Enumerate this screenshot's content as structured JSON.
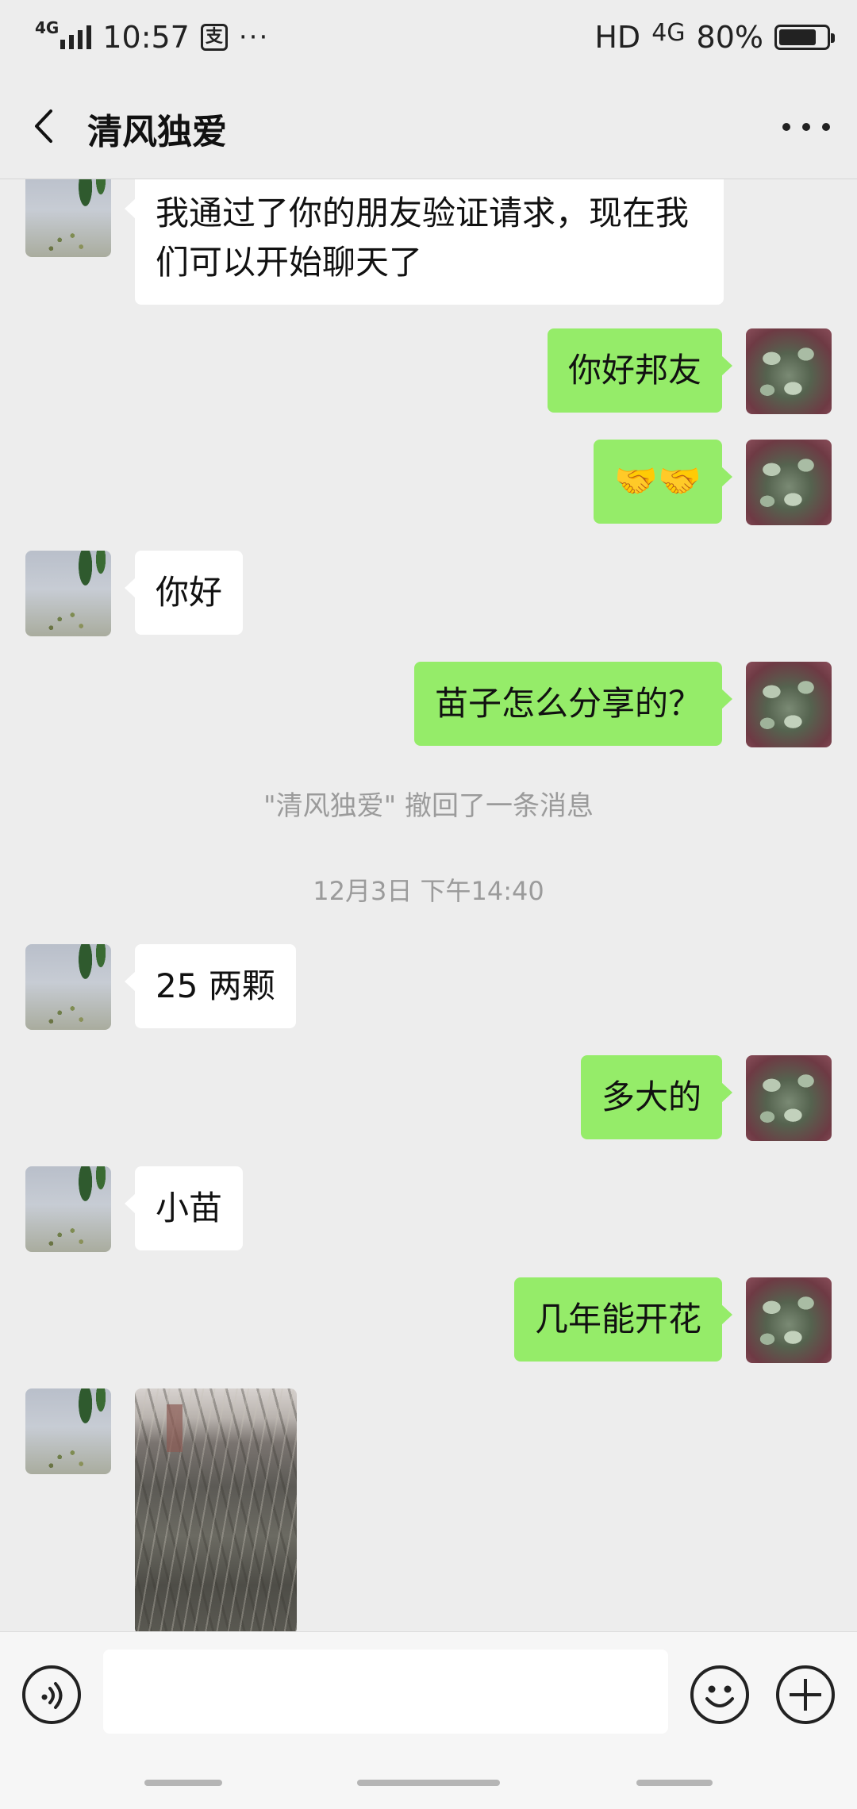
{
  "status_bar": {
    "signal_label": "4G",
    "time": "10:57",
    "pay_icon_glyph": "支",
    "more_dots": "···",
    "hd_label": "HD",
    "network_label": "4G",
    "battery_percent": "80%",
    "battery_level": 0.8
  },
  "header": {
    "title": "清风独爱",
    "back_icon": "chevron-left-icon",
    "more_icon": "more-dots-icon"
  },
  "messages": [
    {
      "side": "in",
      "text": "我通过了你的朋友验证请求，现在我们可以开始聊天了"
    },
    {
      "side": "out",
      "text": "你好邦友"
    },
    {
      "side": "out",
      "text": "🤝🤝"
    },
    {
      "side": "in",
      "text": "你好"
    },
    {
      "side": "out",
      "text": "苗子怎么分享的？"
    },
    {
      "side": "system",
      "text": "\"清风独爱\" 撤回了一条消息"
    },
    {
      "side": "timestamp",
      "text": "12月3日 下午14:40"
    },
    {
      "side": "in",
      "text": "25 两颗"
    },
    {
      "side": "out",
      "text": "多大的"
    },
    {
      "side": "in",
      "text": "小苗"
    },
    {
      "side": "out",
      "text": "几年能开花"
    },
    {
      "side": "in",
      "type": "image",
      "text": ""
    }
  ],
  "input_bar": {
    "voice_icon": "voice-icon",
    "input_value": "",
    "emoji_icon": "emoji-icon",
    "plus_icon": "plus-icon"
  },
  "colors": {
    "background": "#ededed",
    "outgoing_bubble": "#95ec69",
    "incoming_bubble": "#ffffff",
    "system_text": "#9b9b9b"
  }
}
